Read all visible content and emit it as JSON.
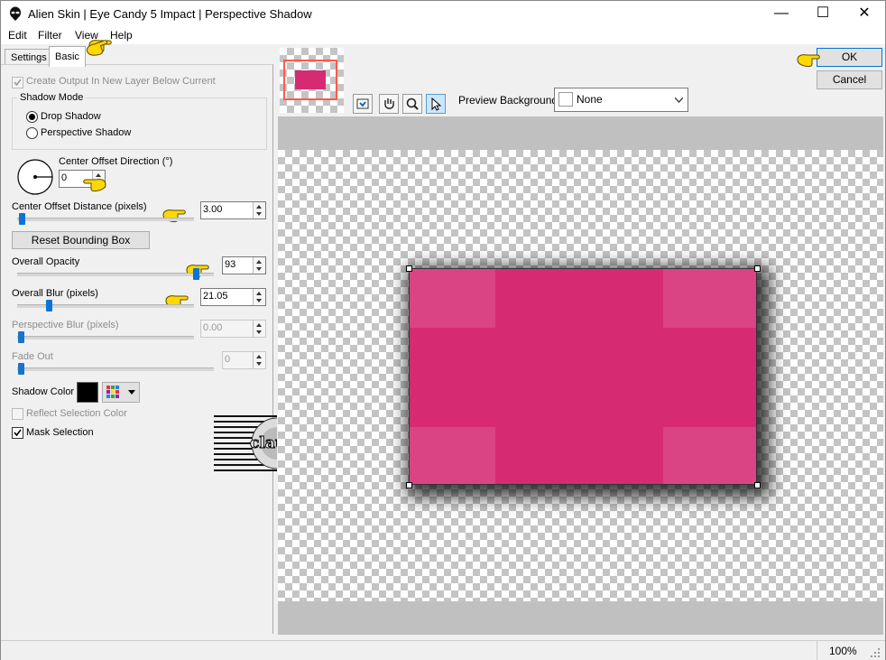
{
  "window": {
    "title": "Alien Skin | Eye Candy 5 Impact | Perspective Shadow",
    "minimize": "—",
    "maximize": "☐",
    "close": "✕"
  },
  "menu": [
    "Edit",
    "Filter",
    "View",
    "Help"
  ],
  "tabs": [
    "Settings",
    "Basic"
  ],
  "basic": {
    "create_output": "Create Output In New Layer Below Current",
    "shadow_mode_label": "Shadow Mode",
    "drop_shadow": "Drop Shadow",
    "perspective_shadow": "Perspective Shadow",
    "center_offset_direction": {
      "label": "Center Offset Direction (°)",
      "value": "0"
    },
    "center_offset_distance": {
      "label": "Center Offset Distance (pixels)",
      "value": "3.00"
    },
    "reset_bbox": "Reset Bounding Box",
    "overall_opacity": {
      "label": "Overall Opacity",
      "value": "93"
    },
    "overall_blur": {
      "label": "Overall Blur (pixels)",
      "value": "21.05"
    },
    "perspective_blur": {
      "label": "Perspective Blur (pixels)",
      "value": "0.00"
    },
    "fade_out": {
      "label": "Fade Out",
      "value": "0"
    },
    "shadow_color": {
      "label": "Shadow Color",
      "color": "#000000"
    },
    "reflect_selection_color": "Reflect Selection Color",
    "mask_selection": "Mask Selection"
  },
  "preview": {
    "background_label": "Preview Background:",
    "background_value": "None",
    "shape_color": "#d62b73",
    "tools": [
      "hand-preview-icon",
      "hand-pan-icon",
      "zoom-icon",
      "arrow-select-icon"
    ]
  },
  "buttons": {
    "ok": "OK",
    "cancel": "Cancel"
  },
  "status": {
    "zoom": "100%"
  },
  "watermark": {
    "text": "claudia"
  }
}
